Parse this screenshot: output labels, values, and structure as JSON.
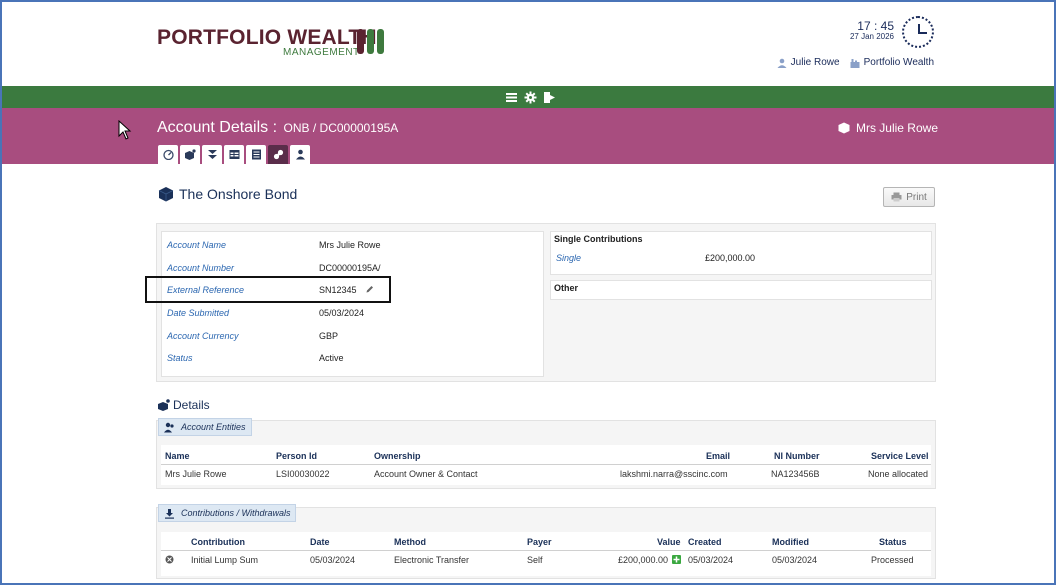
{
  "header": {
    "logo_main": "PORTFOLIO WEALTH",
    "logo_sub": "MANAGEMENT",
    "logo_colors": [
      "#5a2330",
      "#3e7a3e",
      "#3e7a3e"
    ],
    "time": "17 : 45",
    "date": "27 Jan 2026",
    "user_name": "Julie Rowe",
    "company": "Portfolio Wealth"
  },
  "toolbar": {
    "icons": [
      "menu-icon",
      "gear-icon",
      "logout-icon"
    ]
  },
  "account_bar": {
    "title": "Account Details :",
    "account_ref": "ONB / DC00000195A",
    "client": "Mrs Julie Rowe",
    "tabs": [
      "dashboard-icon",
      "account-icon",
      "transfer-icon",
      "table-icon",
      "ledger-icon",
      "tools-icon",
      "person-icon"
    ],
    "active_tab": 5
  },
  "product": {
    "title": "The Onshore Bond",
    "print_label": "Print"
  },
  "account_info": {
    "rows": [
      {
        "label": "Account Name",
        "value": "Mrs Julie Rowe"
      },
      {
        "label": "Account Number",
        "value": "DC00000195A/"
      },
      {
        "label": "External Reference",
        "value": "SN12345"
      },
      {
        "label": "Date Submitted",
        "value": "05/03/2024"
      },
      {
        "label": "Account Currency",
        "value": "GBP"
      },
      {
        "label": "Status",
        "value": "Active"
      }
    ]
  },
  "contributions_summary": {
    "single_header": "Single Contributions",
    "single_label": "Single",
    "single_value": "£200,000.00",
    "other_header": "Other"
  },
  "details": {
    "title": "Details",
    "entities_tab": "Account Entities",
    "entities_headers": [
      "Name",
      "Person Id",
      "Ownership",
      "Email",
      "NI Number",
      "Service Level"
    ],
    "entities_rows": [
      [
        "Mrs Julie Rowe",
        "LSI00030022",
        "Account Owner & Contact",
        "lakshmi.narra@sscinc.com",
        "NA123456B",
        "None allocated"
      ]
    ],
    "contrib_tab": "Contributions / Withdrawals",
    "contrib_headers": [
      "Contribution",
      "Date",
      "Method",
      "Payer",
      "Value",
      "Created",
      "Modified",
      "Status"
    ],
    "contrib_rows": [
      [
        "Initial Lump Sum",
        "05/03/2024",
        "Electronic Transfer",
        "Self",
        "£200,000.00",
        "05/03/2024",
        "05/03/2024",
        "Processed"
      ]
    ]
  },
  "colors": {
    "green_bar": "#3b7a3f",
    "purple_bar": "#a84d7f",
    "label_blue": "#2a66b0",
    "navy": "#1a3058"
  }
}
